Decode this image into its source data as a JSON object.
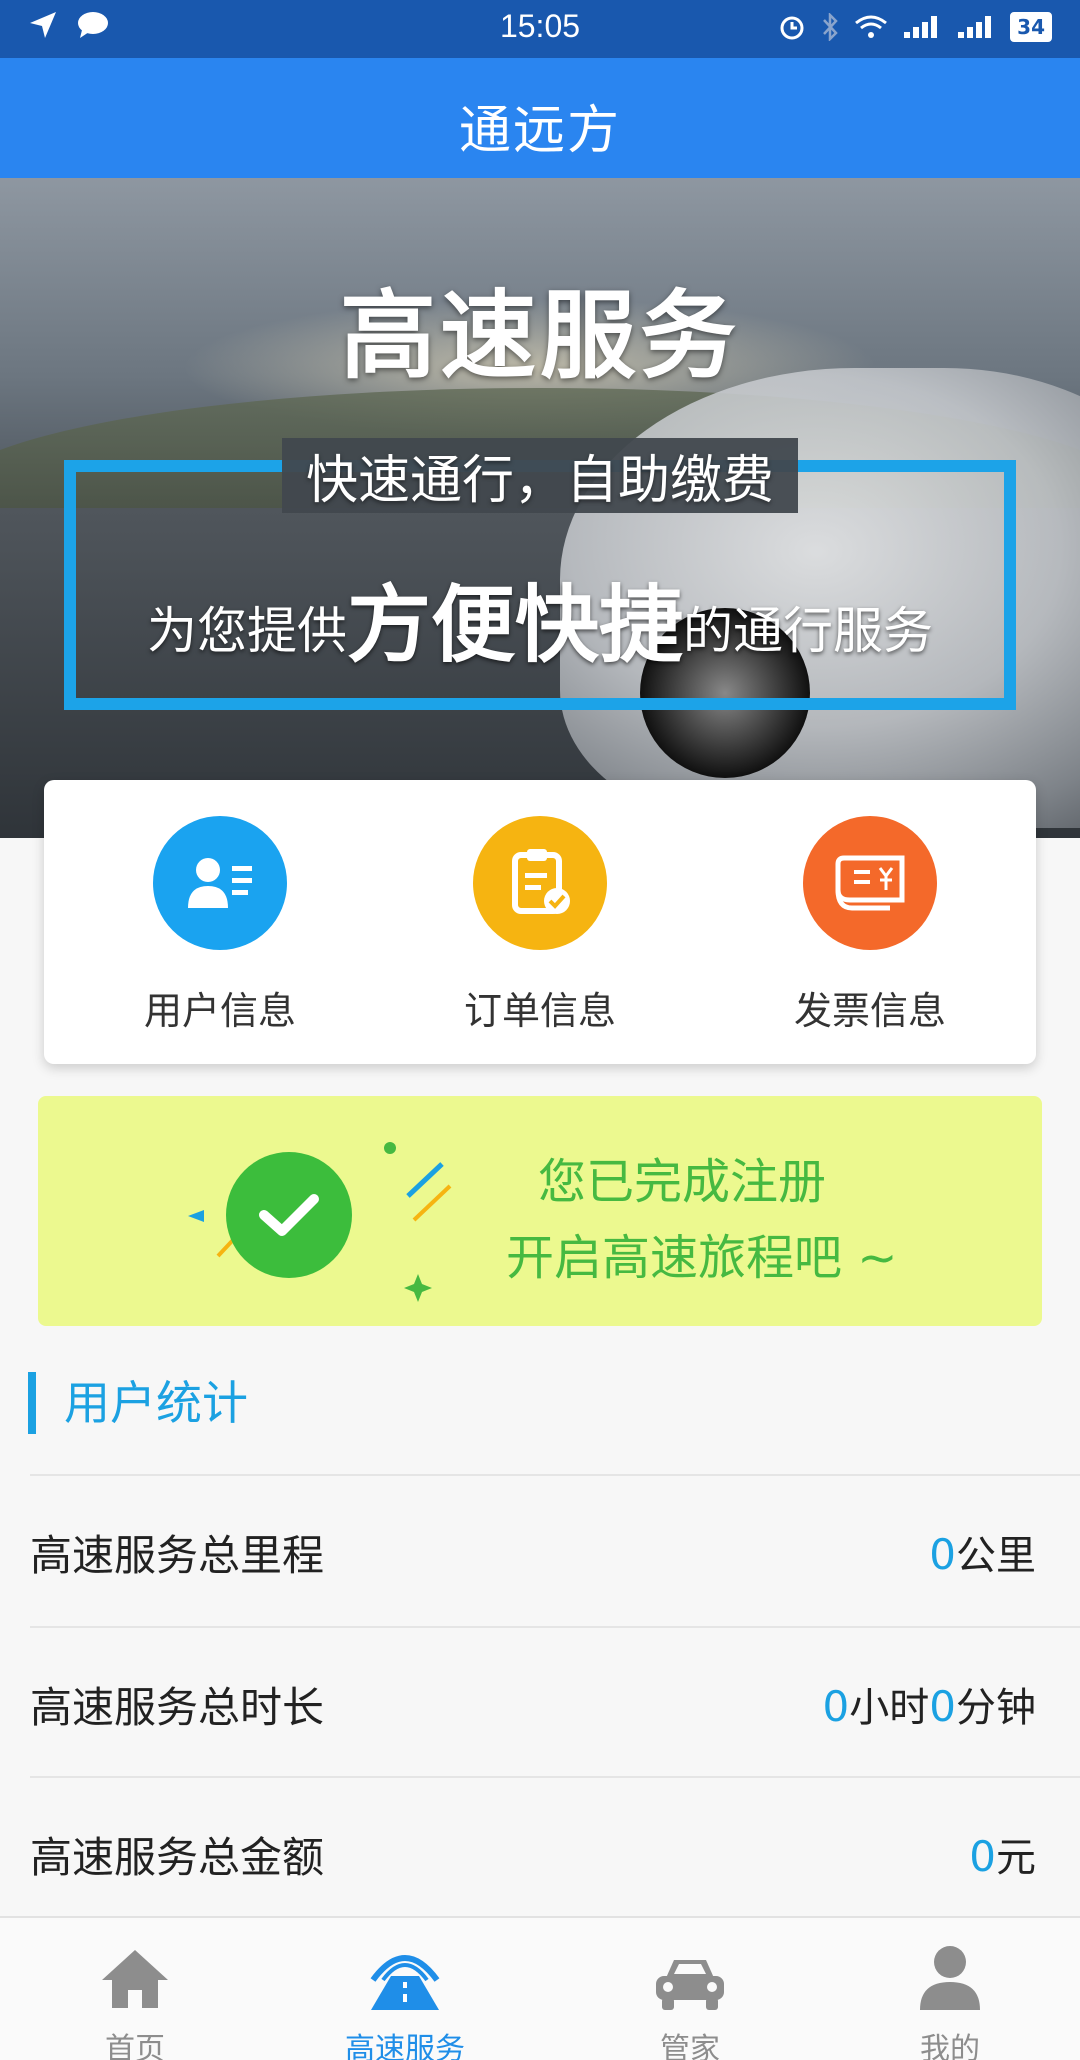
{
  "status_bar": {
    "time": "15:05",
    "battery": "34"
  },
  "app": {
    "title": "通远方"
  },
  "banner": {
    "heading": "高速服务",
    "subtitle": "快速通行，自助缴费",
    "tagline_pre": "为您提供",
    "tagline_bold": "方便快捷",
    "tagline_post": "的通行服务"
  },
  "quick_actions": [
    {
      "label": "用户信息",
      "icon": "user-info-icon",
      "color": "#1aa3f0"
    },
    {
      "label": "订单信息",
      "icon": "order-icon",
      "color": "#f6b411"
    },
    {
      "label": "发票信息",
      "icon": "invoice-icon",
      "color": "#f4692a"
    }
  ],
  "registration": {
    "line1": "您已完成注册",
    "line2": "开启高速旅程吧 ~"
  },
  "stats": {
    "title": "用户统计",
    "rows": [
      {
        "label": "高速服务总里程",
        "value": "0",
        "unit": "公里"
      },
      {
        "label": "高速服务总时长",
        "hours": "0",
        "hours_unit": "小时",
        "minutes": "0",
        "minutes_unit": "分钟"
      },
      {
        "label": "高速服务总金额",
        "value": "0",
        "unit": "元"
      }
    ]
  },
  "tabs": [
    {
      "label": "首页",
      "icon": "home-icon",
      "active": false
    },
    {
      "label": "高速服务",
      "icon": "highway-icon",
      "active": true
    },
    {
      "label": "管家",
      "icon": "car-icon",
      "active": false
    },
    {
      "label": "我的",
      "icon": "profile-icon",
      "active": false
    }
  ],
  "colors": {
    "accent": "#1ba1e2",
    "title_bar": "#2a85f0",
    "status_bar": "#1958ae",
    "success": "#46b941"
  }
}
